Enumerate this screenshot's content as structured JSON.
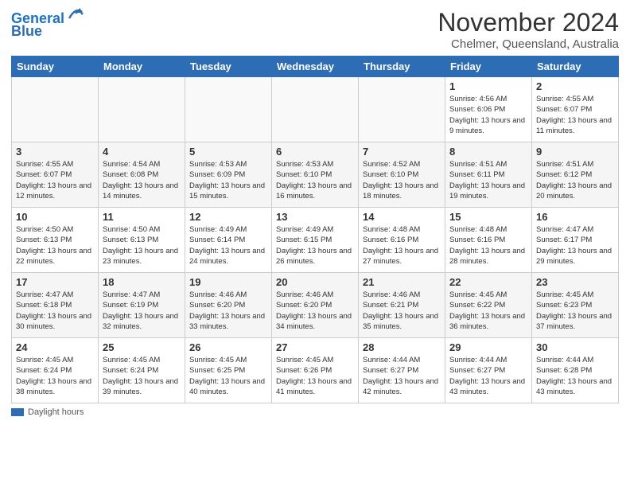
{
  "logo": {
    "line1": "General",
    "line2": "Blue"
  },
  "title": "November 2024",
  "subtitle": "Chelmer, Queensland, Australia",
  "header_days": [
    "Sunday",
    "Monday",
    "Tuesday",
    "Wednesday",
    "Thursday",
    "Friday",
    "Saturday"
  ],
  "weeks": [
    [
      {
        "day": "",
        "info": ""
      },
      {
        "day": "",
        "info": ""
      },
      {
        "day": "",
        "info": ""
      },
      {
        "day": "",
        "info": ""
      },
      {
        "day": "",
        "info": ""
      },
      {
        "day": "1",
        "info": "Sunrise: 4:56 AM\nSunset: 6:06 PM\nDaylight: 13 hours and 9 minutes."
      },
      {
        "day": "2",
        "info": "Sunrise: 4:55 AM\nSunset: 6:07 PM\nDaylight: 13 hours and 11 minutes."
      }
    ],
    [
      {
        "day": "3",
        "info": "Sunrise: 4:55 AM\nSunset: 6:07 PM\nDaylight: 13 hours and 12 minutes."
      },
      {
        "day": "4",
        "info": "Sunrise: 4:54 AM\nSunset: 6:08 PM\nDaylight: 13 hours and 14 minutes."
      },
      {
        "day": "5",
        "info": "Sunrise: 4:53 AM\nSunset: 6:09 PM\nDaylight: 13 hours and 15 minutes."
      },
      {
        "day": "6",
        "info": "Sunrise: 4:53 AM\nSunset: 6:10 PM\nDaylight: 13 hours and 16 minutes."
      },
      {
        "day": "7",
        "info": "Sunrise: 4:52 AM\nSunset: 6:10 PM\nDaylight: 13 hours and 18 minutes."
      },
      {
        "day": "8",
        "info": "Sunrise: 4:51 AM\nSunset: 6:11 PM\nDaylight: 13 hours and 19 minutes."
      },
      {
        "day": "9",
        "info": "Sunrise: 4:51 AM\nSunset: 6:12 PM\nDaylight: 13 hours and 20 minutes."
      }
    ],
    [
      {
        "day": "10",
        "info": "Sunrise: 4:50 AM\nSunset: 6:13 PM\nDaylight: 13 hours and 22 minutes."
      },
      {
        "day": "11",
        "info": "Sunrise: 4:50 AM\nSunset: 6:13 PM\nDaylight: 13 hours and 23 minutes."
      },
      {
        "day": "12",
        "info": "Sunrise: 4:49 AM\nSunset: 6:14 PM\nDaylight: 13 hours and 24 minutes."
      },
      {
        "day": "13",
        "info": "Sunrise: 4:49 AM\nSunset: 6:15 PM\nDaylight: 13 hours and 26 minutes."
      },
      {
        "day": "14",
        "info": "Sunrise: 4:48 AM\nSunset: 6:16 PM\nDaylight: 13 hours and 27 minutes."
      },
      {
        "day": "15",
        "info": "Sunrise: 4:48 AM\nSunset: 6:16 PM\nDaylight: 13 hours and 28 minutes."
      },
      {
        "day": "16",
        "info": "Sunrise: 4:47 AM\nSunset: 6:17 PM\nDaylight: 13 hours and 29 minutes."
      }
    ],
    [
      {
        "day": "17",
        "info": "Sunrise: 4:47 AM\nSunset: 6:18 PM\nDaylight: 13 hours and 30 minutes."
      },
      {
        "day": "18",
        "info": "Sunrise: 4:47 AM\nSunset: 6:19 PM\nDaylight: 13 hours and 32 minutes."
      },
      {
        "day": "19",
        "info": "Sunrise: 4:46 AM\nSunset: 6:20 PM\nDaylight: 13 hours and 33 minutes."
      },
      {
        "day": "20",
        "info": "Sunrise: 4:46 AM\nSunset: 6:20 PM\nDaylight: 13 hours and 34 minutes."
      },
      {
        "day": "21",
        "info": "Sunrise: 4:46 AM\nSunset: 6:21 PM\nDaylight: 13 hours and 35 minutes."
      },
      {
        "day": "22",
        "info": "Sunrise: 4:45 AM\nSunset: 6:22 PM\nDaylight: 13 hours and 36 minutes."
      },
      {
        "day": "23",
        "info": "Sunrise: 4:45 AM\nSunset: 6:23 PM\nDaylight: 13 hours and 37 minutes."
      }
    ],
    [
      {
        "day": "24",
        "info": "Sunrise: 4:45 AM\nSunset: 6:24 PM\nDaylight: 13 hours and 38 minutes."
      },
      {
        "day": "25",
        "info": "Sunrise: 4:45 AM\nSunset: 6:24 PM\nDaylight: 13 hours and 39 minutes."
      },
      {
        "day": "26",
        "info": "Sunrise: 4:45 AM\nSunset: 6:25 PM\nDaylight: 13 hours and 40 minutes."
      },
      {
        "day": "27",
        "info": "Sunrise: 4:45 AM\nSunset: 6:26 PM\nDaylight: 13 hours and 41 minutes."
      },
      {
        "day": "28",
        "info": "Sunrise: 4:44 AM\nSunset: 6:27 PM\nDaylight: 13 hours and 42 minutes."
      },
      {
        "day": "29",
        "info": "Sunrise: 4:44 AM\nSunset: 6:27 PM\nDaylight: 13 hours and 43 minutes."
      },
      {
        "day": "30",
        "info": "Sunrise: 4:44 AM\nSunset: 6:28 PM\nDaylight: 13 hours and 43 minutes."
      }
    ]
  ],
  "legend": {
    "label": "Daylight hours"
  }
}
